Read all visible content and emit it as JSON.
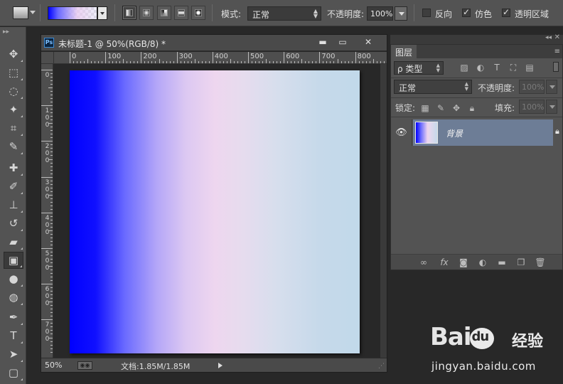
{
  "options_bar": {
    "mode_label": "模式:",
    "mode_value": "正常",
    "opacity_label": "不透明度:",
    "opacity_value": "100%",
    "reverse_label": "反向",
    "reverse_checked": false,
    "dither_label": "仿色",
    "dither_checked": true,
    "transparency_label": "透明区域",
    "transparency_checked": true,
    "active_gradient_type": "linear"
  },
  "tools": [
    {
      "name": "move-tool",
      "icon": "move-icon",
      "glyph": "✥"
    },
    {
      "name": "marquee-tool",
      "icon": "rect-marquee-icon",
      "glyph": "⬚"
    },
    {
      "name": "lasso-tool",
      "icon": "lasso-icon",
      "glyph": "◌"
    },
    {
      "name": "magic-wand-tool",
      "icon": "magic-wand-icon",
      "glyph": "✦"
    },
    {
      "name": "crop-tool",
      "icon": "crop-icon",
      "glyph": "⌗"
    },
    {
      "name": "eyedropper-tool",
      "icon": "eyedropper-icon",
      "glyph": "✎"
    },
    {
      "name": "healing-tool",
      "icon": "healing-brush-icon",
      "glyph": "✚"
    },
    {
      "name": "brush-tool",
      "icon": "brush-icon",
      "glyph": "✐"
    },
    {
      "name": "clone-stamp-tool",
      "icon": "stamp-icon",
      "glyph": "⊥"
    },
    {
      "name": "history-brush-tool",
      "icon": "history-brush-icon",
      "glyph": "↺"
    },
    {
      "name": "eraser-tool",
      "icon": "eraser-icon",
      "glyph": "▰"
    },
    {
      "name": "gradient-tool",
      "icon": "gradient-icon",
      "glyph": "▣"
    },
    {
      "name": "blur-tool",
      "icon": "blur-drop-icon",
      "glyph": "●"
    },
    {
      "name": "dodge-tool",
      "icon": "dodge-icon",
      "glyph": "◍"
    },
    {
      "name": "pen-tool",
      "icon": "pen-icon",
      "glyph": "✒"
    },
    {
      "name": "type-tool",
      "icon": "type-icon",
      "glyph": "T"
    },
    {
      "name": "path-selection-tool",
      "icon": "arrow-icon",
      "glyph": "➤"
    },
    {
      "name": "shape-tool",
      "icon": "rounded-rect-icon",
      "glyph": "▢"
    }
  ],
  "document": {
    "title": "未标题-1 @ 50%(RGB/8) *",
    "ps_badge": "Ps",
    "minimize_glyph": "▬",
    "maximize_glyph": "▭",
    "close_glyph": "✕",
    "ruler_top_labels": [
      "0",
      "100",
      "200",
      "300",
      "400",
      "500",
      "600",
      "700",
      "800"
    ],
    "ruler_left_labels": [
      "0",
      "100",
      "200",
      "300",
      "400",
      "500",
      "600",
      "700"
    ],
    "zoom": "50%",
    "doc_info": "文档:1.85M/1.85M",
    "gradient_colors": [
      "#0000ff",
      "#eed6ef",
      "#c1d9ea"
    ]
  },
  "layers_panel": {
    "tab_label": "图层",
    "filter_label": "ρ 类型",
    "blend_mode": "正常",
    "opacity_label": "不透明度:",
    "opacity_value": "100%",
    "lock_label": "锁定:",
    "fill_label": "填充:",
    "fill_value": "100%",
    "layers": [
      {
        "name": "背景",
        "visible": true,
        "locked": true,
        "selected": true
      }
    ]
  },
  "watermark": {
    "brand_left": "Bai",
    "brand_right": "经验",
    "url": "jingyan.baidu.com"
  }
}
